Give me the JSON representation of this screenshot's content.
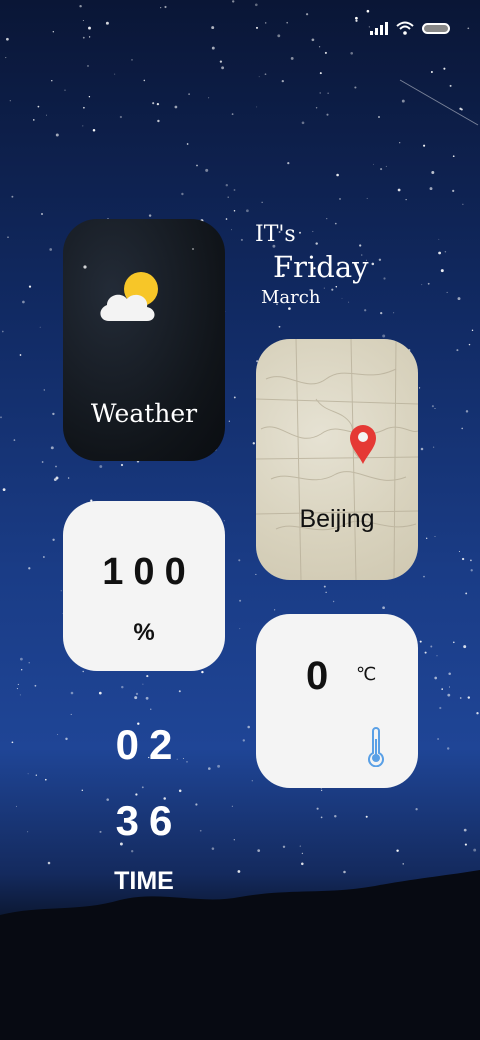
{
  "status_bar": {
    "signal_icon": "signal-bars-icon",
    "wifi_icon": "wifi-icon",
    "battery_icon": "battery-icon"
  },
  "weather_widget": {
    "label": "Weather",
    "icon": "partly-sunny-icon"
  },
  "date_text": {
    "prefix": "IT's",
    "day": "Friday",
    "month": "March"
  },
  "location_widget": {
    "city": "Beijing",
    "icon": "map-pin-icon"
  },
  "battery_widget": {
    "value": "100",
    "unit": "%"
  },
  "temperature_widget": {
    "value": "0",
    "unit": "℃",
    "icon": "thermometer-icon"
  },
  "clock": {
    "hours": "02",
    "minutes": "36",
    "label": "TIME"
  },
  "colors": {
    "card_bg": "#f4f4f4",
    "pin_red": "#e53935",
    "thermometer_blue": "#5aa0e6",
    "sun_yellow": "#f7c628"
  }
}
